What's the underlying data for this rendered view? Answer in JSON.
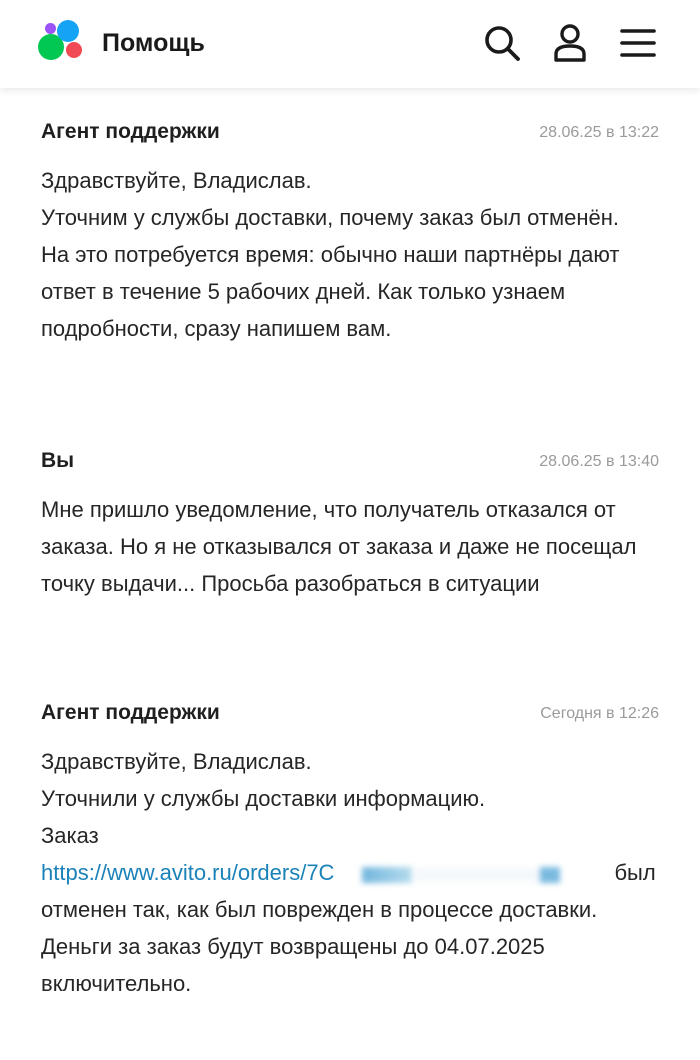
{
  "header": {
    "title": "Помощь",
    "logo_colors": [
      "#00c853",
      "#14a3f5",
      "#9b53f5",
      "#f24a54"
    ],
    "icons": [
      "search-icon",
      "profile-icon",
      "menu-icon"
    ]
  },
  "messages": [
    {
      "author": "Агент поддержки",
      "time": "28.06.25 в 13:22",
      "paragraphs": [
        "Здравствуйте, Владислав.",
        "Уточним у службы доставки, почему заказ был отменён.",
        "На это потребуется время: обычно наши партнёры дают ответ в течение 5 рабочих дней. Как только узнаем подробности, сразу напишем вам."
      ]
    },
    {
      "author": "Вы",
      "time": "28.06.25 в 13:40",
      "paragraphs": [
        "Мне пришло уведомление, что получатель отказался от заказа. Но я не отказывался от заказа и даже не посещал точку выдачи... Просьба разобраться в ситуации"
      ]
    },
    {
      "author": "Агент поддержки",
      "time": "Сегодня в 12:26",
      "paragraphs": [
        "Здравствуйте, Владислав.",
        "Уточнили у службы доставки информацию.",
        "Заказ"
      ],
      "order_link": "https://www.avito.ru/orders/7С",
      "after_link": "был отменен так, как был поврежден в процессе доставки.",
      "refund": "Деньги за заказ будут возвращены до 04.07.2025 включительно."
    }
  ],
  "colors": {
    "link": "#1a82b8",
    "timestamp": "#9a9a9a",
    "text": "#262626"
  }
}
